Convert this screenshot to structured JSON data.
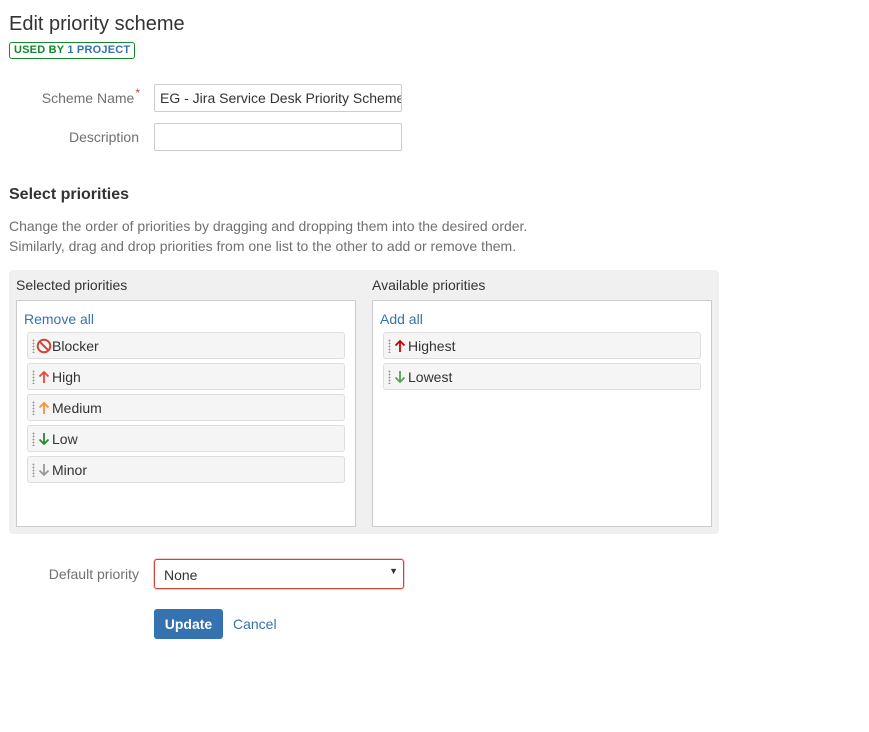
{
  "header": {
    "title": "Edit priority scheme",
    "badge_prefix": "USED BY ",
    "badge_link": "1 PROJECT"
  },
  "form": {
    "scheme_name_label": "Scheme Name",
    "scheme_name_required": "*",
    "scheme_name_value": "EG - Jira Service Desk Priority Scheme",
    "description_label": "Description",
    "description_value": ""
  },
  "priorities_section": {
    "heading": "Select priorities",
    "description_line1": "Change the order of priorities by dragging and dropping them into the desired order.",
    "description_line2": "Similarly, drag and drop priorities from one list to the other to add or remove them.",
    "selected": {
      "label": "Selected priorities",
      "action": "Remove all",
      "items": [
        {
          "name": "Blocker",
          "icon": "blocker-icon",
          "color": "#d04437"
        },
        {
          "name": "High",
          "icon": "arrow-up-icon",
          "color": "#e5493a"
        },
        {
          "name": "Medium",
          "icon": "arrow-up-icon",
          "color": "#f79232"
        },
        {
          "name": "Low",
          "icon": "arrow-down-icon",
          "color": "#2a8735"
        },
        {
          "name": "Minor",
          "icon": "arrow-down-icon",
          "color": "#999999"
        }
      ]
    },
    "available": {
      "label": "Available priorities",
      "action": "Add all",
      "items": [
        {
          "name": "Highest",
          "icon": "arrow-up-icon",
          "color": "#ce0000"
        },
        {
          "name": "Lowest",
          "icon": "arrow-down-icon",
          "color": "#55a557"
        }
      ]
    }
  },
  "default_priority": {
    "label": "Default priority",
    "selected": "None"
  },
  "actions": {
    "update_label": "Update",
    "cancel_label": "Cancel"
  },
  "colors": {
    "accent": "#3572b0",
    "success": "#14892c",
    "error": "#d04437"
  }
}
